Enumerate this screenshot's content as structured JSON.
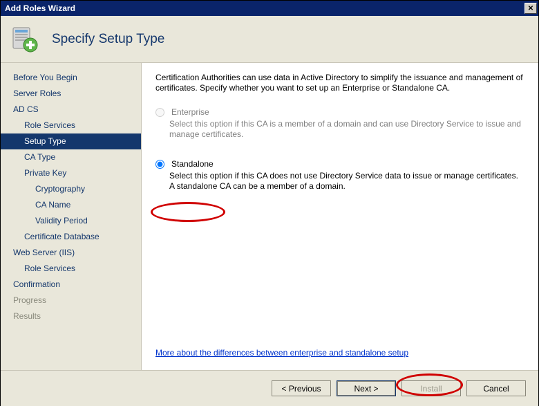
{
  "window": {
    "title": "Add Roles Wizard"
  },
  "header": {
    "title": "Specify Setup Type"
  },
  "nav": {
    "items": [
      {
        "label": "Before You Begin",
        "level": 0,
        "selected": false
      },
      {
        "label": "Server Roles",
        "level": 0,
        "selected": false
      },
      {
        "label": "AD CS",
        "level": 0,
        "selected": false
      },
      {
        "label": "Role Services",
        "level": 1,
        "selected": false
      },
      {
        "label": "Setup Type",
        "level": 1,
        "selected": true
      },
      {
        "label": "CA Type",
        "level": 1,
        "selected": false
      },
      {
        "label": "Private Key",
        "level": 1,
        "selected": false
      },
      {
        "label": "Cryptography",
        "level": 2,
        "selected": false
      },
      {
        "label": "CA Name",
        "level": 2,
        "selected": false
      },
      {
        "label": "Validity Period",
        "level": 2,
        "selected": false
      },
      {
        "label": "Certificate Database",
        "level": 1,
        "selected": false
      },
      {
        "label": "Web Server (IIS)",
        "level": 0,
        "selected": false
      },
      {
        "label": "Role Services",
        "level": 1,
        "selected": false
      },
      {
        "label": "Confirmation",
        "level": 0,
        "selected": false
      },
      {
        "label": "Progress",
        "level": 0,
        "selected": false,
        "disabled": true
      },
      {
        "label": "Results",
        "level": 0,
        "selected": false,
        "disabled": true
      }
    ]
  },
  "content": {
    "description": "Certification Authorities can use data in Active Directory to simplify the issuance and management of certificates. Specify whether you want to set up an Enterprise or Standalone CA.",
    "options": {
      "enterprise": {
        "label": "Enterprise",
        "sub": "Select this option if this CA is a member of a domain and can use Directory Service to issue and manage certificates.",
        "checked": false,
        "disabled": true
      },
      "standalone": {
        "label": "Standalone",
        "sub": "Select this option if this CA does not use Directory Service data to issue or manage certificates. A standalone CA can be a member of a domain.",
        "checked": true,
        "disabled": false
      }
    },
    "link": "More about the differences between enterprise and standalone setup"
  },
  "footer": {
    "previous": "< Previous",
    "next": "Next >",
    "install": "Install",
    "cancel": "Cancel"
  }
}
